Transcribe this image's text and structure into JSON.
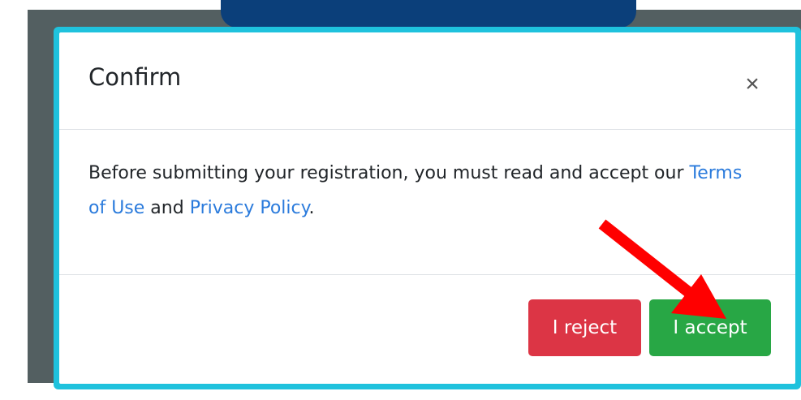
{
  "modal": {
    "title": "Confirm",
    "close_label": "×",
    "body": {
      "text_before": "Before submitting your registration, you must read and accept our ",
      "terms_link": "Terms of Use",
      "text_between": " and ",
      "privacy_link": "Privacy Policy",
      "text_after": "."
    },
    "reject_label": "I reject",
    "accept_label": "I accept"
  },
  "colors": {
    "backdrop": "#535f61",
    "modal_border": "#1fc2dd",
    "reject": "#dc3545",
    "accept": "#28a745",
    "link": "#2b7bdc",
    "annotation_arrow": "#ff0000"
  }
}
